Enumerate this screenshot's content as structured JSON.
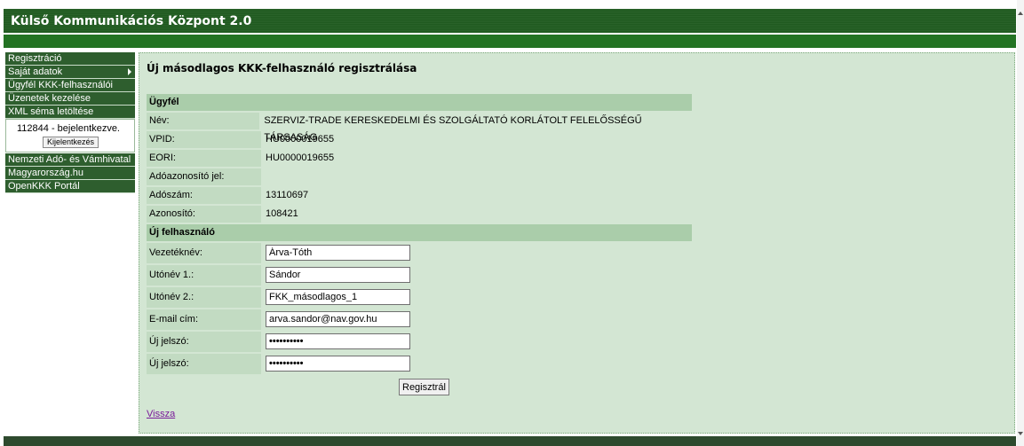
{
  "header": {
    "title": "Külső Kommunikációs Központ 2.0"
  },
  "sidebar": {
    "items_top": [
      {
        "label": "Regisztráció",
        "has_submenu": false
      },
      {
        "label": "Saját adatok",
        "has_submenu": true
      },
      {
        "label": "Ügyfél KKK-felhasználói",
        "has_submenu": false
      },
      {
        "label": "Üzenetek kezelése",
        "has_submenu": false
      },
      {
        "label": "XML séma letöltése",
        "has_submenu": false
      }
    ],
    "login": {
      "status": "112844 - bejelentkezve.",
      "logout_label": "Kijelentkezés"
    },
    "items_bottom": [
      {
        "label": "Nemzeti Adó- és Vámhivatal"
      },
      {
        "label": "Magyarország.hu"
      },
      {
        "label": "OpenKKK Portál"
      }
    ]
  },
  "main": {
    "title": "Új másodlagos KKK-felhasználó regisztrálása",
    "client_section": "Ügyfél",
    "client": [
      {
        "label": "Név:",
        "value": "SZERVIZ-TRADE KERESKEDELMI ÉS SZOLGÁLTATÓ KORLÁTOLT FELELŐSSÉGŰ TÁRSASÁG"
      },
      {
        "label": "VPID:",
        "value": "HU0000019655"
      },
      {
        "label": "EORI:",
        "value": "HU0000019655"
      },
      {
        "label": "Adóazonosító jel:",
        "value": ""
      },
      {
        "label": "Adószám:",
        "value": "13110697"
      },
      {
        "label": "Azonosító:",
        "value": "108421"
      }
    ],
    "user_section": "Új felhasználó",
    "user_fields": [
      {
        "label": "Vezetéknév:",
        "value": "Árva-Tóth",
        "type": "text",
        "name": "last-name-input"
      },
      {
        "label": "Utónév 1.:",
        "value": "Sándor",
        "type": "text",
        "name": "first-name-1-input"
      },
      {
        "label": "Utónév 2.:",
        "value": "FKK_másodlagos_1",
        "type": "text",
        "name": "first-name-2-input"
      },
      {
        "label": "E-mail cím:",
        "value": "arva.sandor@nav.gov.hu",
        "type": "text",
        "name": "email-input"
      },
      {
        "label": "Új jelszó:",
        "value": "••••••••••",
        "type": "password",
        "name": "password-input"
      },
      {
        "label": "Új jelszó:",
        "value": "••••••••••",
        "type": "password",
        "name": "password-confirm-input"
      }
    ],
    "submit_label": "Regisztrál",
    "back_label": "Vissza"
  }
}
